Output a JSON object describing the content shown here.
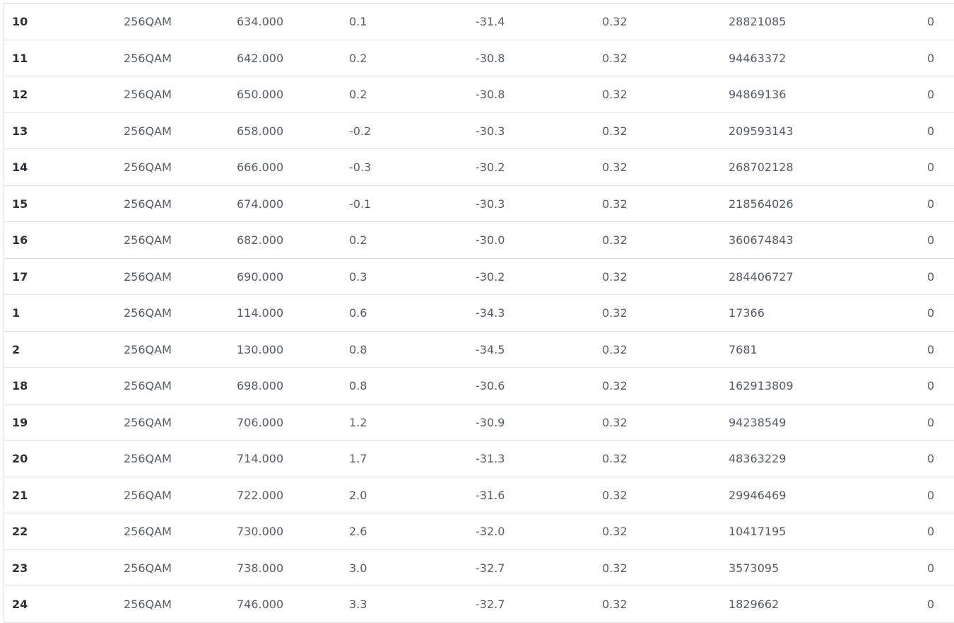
{
  "table": {
    "rows": [
      {
        "channel": "10",
        "modulation": "256QAM",
        "frequency": "634.000",
        "power": "0.1",
        "snr": "-31.4",
        "col6": "0.32",
        "corrected": "28821085",
        "uncorrectables": "0"
      },
      {
        "channel": "11",
        "modulation": "256QAM",
        "frequency": "642.000",
        "power": "0.2",
        "snr": "-30.8",
        "col6": "0.32",
        "corrected": "94463372",
        "uncorrectables": "0"
      },
      {
        "channel": "12",
        "modulation": "256QAM",
        "frequency": "650.000",
        "power": "0.2",
        "snr": "-30.8",
        "col6": "0.32",
        "corrected": "94869136",
        "uncorrectables": "0"
      },
      {
        "channel": "13",
        "modulation": "256QAM",
        "frequency": "658.000",
        "power": "-0.2",
        "snr": "-30.3",
        "col6": "0.32",
        "corrected": "209593143",
        "uncorrectables": "0"
      },
      {
        "channel": "14",
        "modulation": "256QAM",
        "frequency": "666.000",
        "power": "-0.3",
        "snr": "-30.2",
        "col6": "0.32",
        "corrected": "268702128",
        "uncorrectables": "0"
      },
      {
        "channel": "15",
        "modulation": "256QAM",
        "frequency": "674.000",
        "power": "-0.1",
        "snr": "-30.3",
        "col6": "0.32",
        "corrected": "218564026",
        "uncorrectables": "0"
      },
      {
        "channel": "16",
        "modulation": "256QAM",
        "frequency": "682.000",
        "power": "0.2",
        "snr": "-30.0",
        "col6": "0.32",
        "corrected": "360674843",
        "uncorrectables": "0"
      },
      {
        "channel": "17",
        "modulation": "256QAM",
        "frequency": "690.000",
        "power": "0.3",
        "snr": "-30.2",
        "col6": "0.32",
        "corrected": "284406727",
        "uncorrectables": "0"
      },
      {
        "channel": "1",
        "modulation": "256QAM",
        "frequency": "114.000",
        "power": "0.6",
        "snr": "-34.3",
        "col6": "0.32",
        "corrected": "17366",
        "uncorrectables": "0"
      },
      {
        "channel": "2",
        "modulation": "256QAM",
        "frequency": "130.000",
        "power": "0.8",
        "snr": "-34.5",
        "col6": "0.32",
        "corrected": "7681",
        "uncorrectables": "0"
      },
      {
        "channel": "18",
        "modulation": "256QAM",
        "frequency": "698.000",
        "power": "0.8",
        "snr": "-30.6",
        "col6": "0.32",
        "corrected": "162913809",
        "uncorrectables": "0"
      },
      {
        "channel": "19",
        "modulation": "256QAM",
        "frequency": "706.000",
        "power": "1.2",
        "snr": "-30.9",
        "col6": "0.32",
        "corrected": "94238549",
        "uncorrectables": "0"
      },
      {
        "channel": "20",
        "modulation": "256QAM",
        "frequency": "714.000",
        "power": "1.7",
        "snr": "-31.3",
        "col6": "0.32",
        "corrected": "48363229",
        "uncorrectables": "0"
      },
      {
        "channel": "21",
        "modulation": "256QAM",
        "frequency": "722.000",
        "power": "2.0",
        "snr": "-31.6",
        "col6": "0.32",
        "corrected": "29946469",
        "uncorrectables": "0"
      },
      {
        "channel": "22",
        "modulation": "256QAM",
        "frequency": "730.000",
        "power": "2.6",
        "snr": "-32.0",
        "col6": "0.32",
        "corrected": "10417195",
        "uncorrectables": "0"
      },
      {
        "channel": "23",
        "modulation": "256QAM",
        "frequency": "738.000",
        "power": "3.0",
        "snr": "-32.7",
        "col6": "0.32",
        "corrected": "3573095",
        "uncorrectables": "0"
      },
      {
        "channel": "24",
        "modulation": "256QAM",
        "frequency": "746.000",
        "power": "3.3",
        "snr": "-32.7",
        "col6": "0.32",
        "corrected": "1829662",
        "uncorrectables": "0"
      }
    ]
  }
}
